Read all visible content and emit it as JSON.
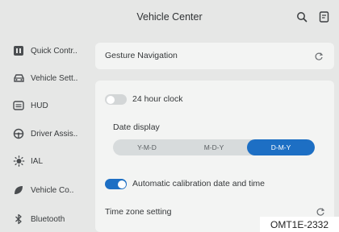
{
  "header": {
    "title": "Vehicle Center",
    "search_icon": "search-icon",
    "manual_icon": "manual-icon"
  },
  "sidebar": {
    "items": [
      {
        "label": "Quick Contr..",
        "icon": "quick-control-icon"
      },
      {
        "label": "Vehicle Sett..",
        "icon": "car-icon"
      },
      {
        "label": "HUD",
        "icon": "hud-icon"
      },
      {
        "label": "Driver Assis..",
        "icon": "steering-wheel-icon"
      },
      {
        "label": "IAL",
        "icon": "headlight-icon"
      },
      {
        "label": "Vehicle Co..",
        "icon": "leaf-icon"
      },
      {
        "label": "Bluetooth",
        "icon": "bluetooth-icon"
      }
    ]
  },
  "gesture": {
    "title": "Gesture Navigation",
    "reset_icon": "reset-icon"
  },
  "time_settings": {
    "clock_label": "24 hour clock",
    "clock_on": false,
    "date_display_label": "Date display",
    "date_formats": [
      "Y-M-D",
      "M-D-Y",
      "D-M-Y"
    ],
    "selected_format": "D-M-Y",
    "auto_calibration_label": "Automatic calibration date and time",
    "auto_calibration_on": true,
    "timezone_label": "Time zone setting",
    "timezone_icon": "reset-icon"
  },
  "caption": "OMT1E-2332",
  "colors": {
    "accent": "#1d6fc4",
    "background": "#e6e7e6",
    "card": "#f3f4f3",
    "toggle_off": "#d3d6d7"
  }
}
